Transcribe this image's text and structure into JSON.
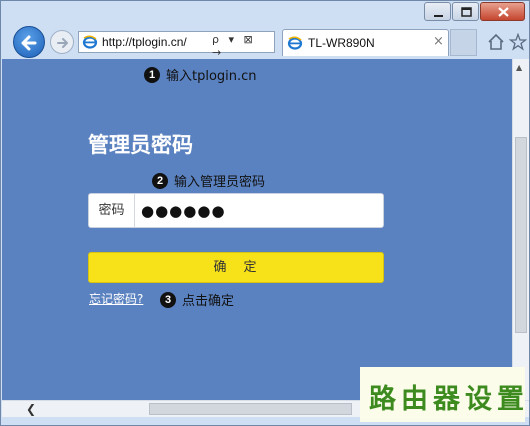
{
  "browser": {
    "address": "http://tplogin.cn/",
    "address_tools": "ρ ▾ ⊠ →",
    "tab_title": "TL-WR890N",
    "tab_close": "×",
    "icons": [
      "back-arrow-icon",
      "forward-arrow-icon",
      "ie-logo-icon",
      "search-icon",
      "home-icon",
      "star-icon"
    ]
  },
  "steps": [
    {
      "num": "1",
      "text": "输入tplogin.cn"
    },
    {
      "num": "2",
      "text": "输入管理员密码"
    },
    {
      "num": "3",
      "text": "点击确定"
    }
  ],
  "login": {
    "heading": "管理员密码",
    "password_label": "密码",
    "password_value": "●●●●●●",
    "confirm_label": "确　定",
    "forgot_link": "忘记密码?"
  },
  "watermark": {
    "text": "路由器设置"
  },
  "colors": {
    "page_bg": "#5b82c0",
    "button_yellow": "#f7e21a",
    "watermark_green": "#3d8b1f"
  }
}
